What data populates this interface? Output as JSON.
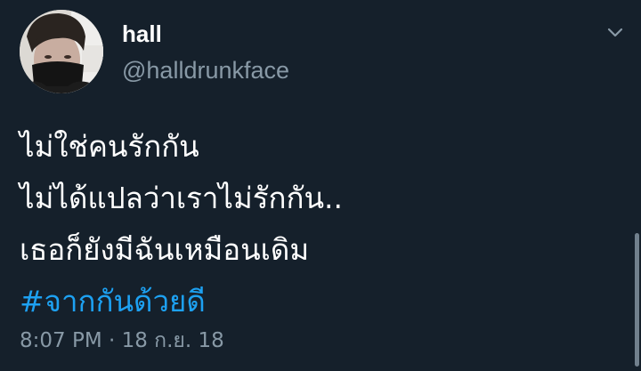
{
  "user": {
    "display_name": "hall",
    "handle": "@halldrunkface"
  },
  "tweet": {
    "lines": [
      "ไม่ใช่คนรักกัน",
      "ไม่ได้แปลว่าเราไม่รักกัน..",
      "เธอก็ยังมีฉันเหมือนเดิม"
    ],
    "hashtag": "#จากกันด้วยดี",
    "timestamp": "8:07 PM · 18 ก.ย. 18"
  },
  "icons": {
    "menu": "chevron-down-icon",
    "avatar": "profile-photo"
  },
  "colors": {
    "background": "#15202b",
    "text": "#ffffff",
    "secondary_text": "#8899a6",
    "hashtag": "#1da1f2"
  }
}
